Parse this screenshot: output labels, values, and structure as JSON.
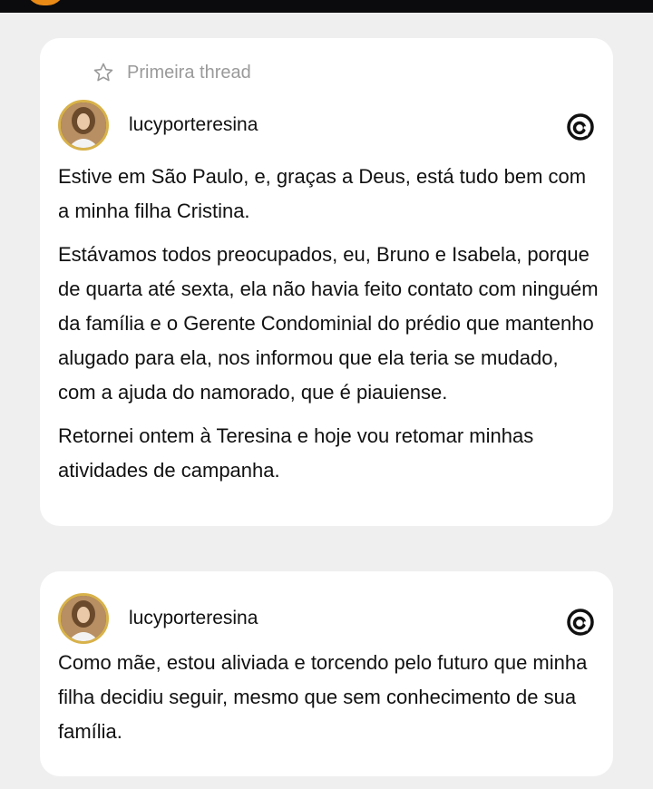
{
  "post1": {
    "label": "Primeira thread",
    "username": "lucyporteresina",
    "paragraphs": [
      "Estive em São Paulo, e, graças a Deus, está tudo bem com a minha filha Cristina.",
      "Estávamos todos preocupados, eu, Bruno e Isabela, porque de quarta até sexta, ela não havia feito contato com ninguém da família e o Gerente Condominial do prédio que mantenho alugado para ela,  nos informou que ela teria se mudado, com a ajuda do namorado, que é piauiense.",
      "Retornei ontem à Teresina e hoje vou retomar minhas atividades de campanha."
    ]
  },
  "post2": {
    "username": "lucyporteresina",
    "paragraphs": [
      "Como mãe, estou aliviada e torcendo pelo futuro que minha filha decidiu seguir, mesmo que sem conhecimento de sua família."
    ]
  },
  "icons": {
    "star": "star-outline-icon",
    "threads": "threads-logo-icon"
  },
  "colors": {
    "background": "#efefef",
    "card": "#ffffff",
    "label_gray": "#9a9a9a",
    "avatar_ring": "#d8b24a"
  }
}
